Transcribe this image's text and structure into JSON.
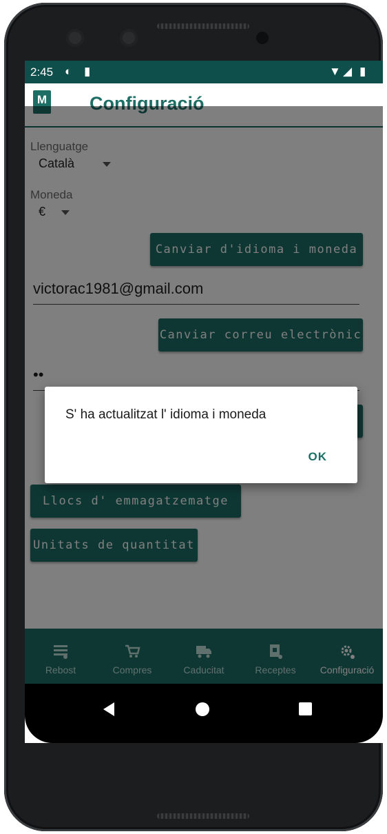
{
  "statusbar": {
    "time": "2:45"
  },
  "header": {
    "logo_letter": "M",
    "title": "Configuració"
  },
  "language": {
    "label": "Llenguatge",
    "value": "Català"
  },
  "currency": {
    "label": "Moneda",
    "value": "€"
  },
  "buttons": {
    "change_language": "Canviar d'idioma i moneda",
    "change_email": "Canviar correu electrònic",
    "storage_places": "Llocs d' emmagatzematge",
    "quantity_units": "Unitats de quantitat"
  },
  "email": {
    "value": "victorac1981@gmail.com"
  },
  "password": {
    "value": "••"
  },
  "dialog": {
    "message": "S' ha actualitzat l' idioma i moneda",
    "ok": "OK"
  },
  "bottom_nav": [
    {
      "label": "Rebost",
      "icon": "list-icon"
    },
    {
      "label": "Compres",
      "icon": "cart-icon"
    },
    {
      "label": "Caducitat",
      "icon": "truck-icon"
    },
    {
      "label": "Receptes",
      "icon": "recipe-icon"
    },
    {
      "label": "Configuració",
      "icon": "gear-icon",
      "active": true
    }
  ],
  "colors": {
    "primary": "#1d6f66",
    "statusbar": "#0f4f4b"
  }
}
